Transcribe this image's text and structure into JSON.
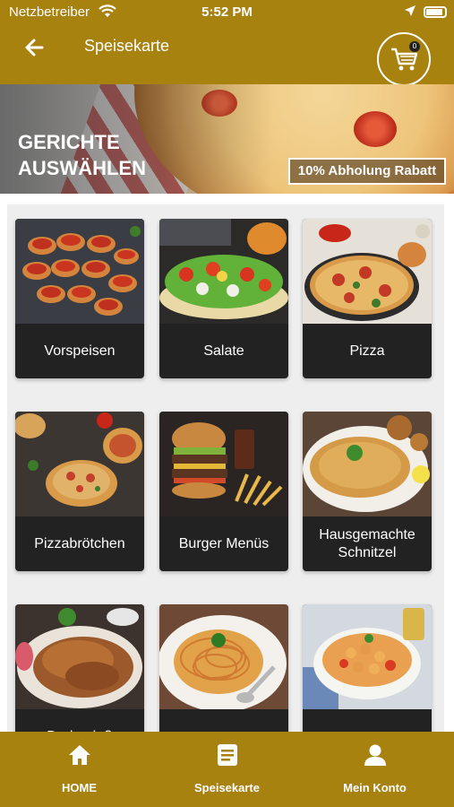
{
  "status_bar": {
    "carrier": "Netzbetreiber",
    "time": "5:52 PM"
  },
  "header": {
    "title": "Speisekarte",
    "cart_count": "0"
  },
  "banner": {
    "title_line1": "GERICHTE",
    "title_line2": "AUSWÄHLEN",
    "badge": "10% Abholung Rabatt"
  },
  "categories": [
    {
      "label": "Vorspeisen"
    },
    {
      "label": "Salate"
    },
    {
      "label": "Pizza"
    },
    {
      "label": "Pizzabrötchen"
    },
    {
      "label": "Burger Menüs"
    },
    {
      "label": "Hausgemachte Schnitzel"
    },
    {
      "label": "Drehspieß"
    },
    {
      "label": ""
    },
    {
      "label": ""
    }
  ],
  "bottom_nav": {
    "home": "HOME",
    "menu": "Speisekarte",
    "account": "Mein Konto"
  },
  "colors": {
    "brand": "#a8820f",
    "card": "#222222"
  }
}
